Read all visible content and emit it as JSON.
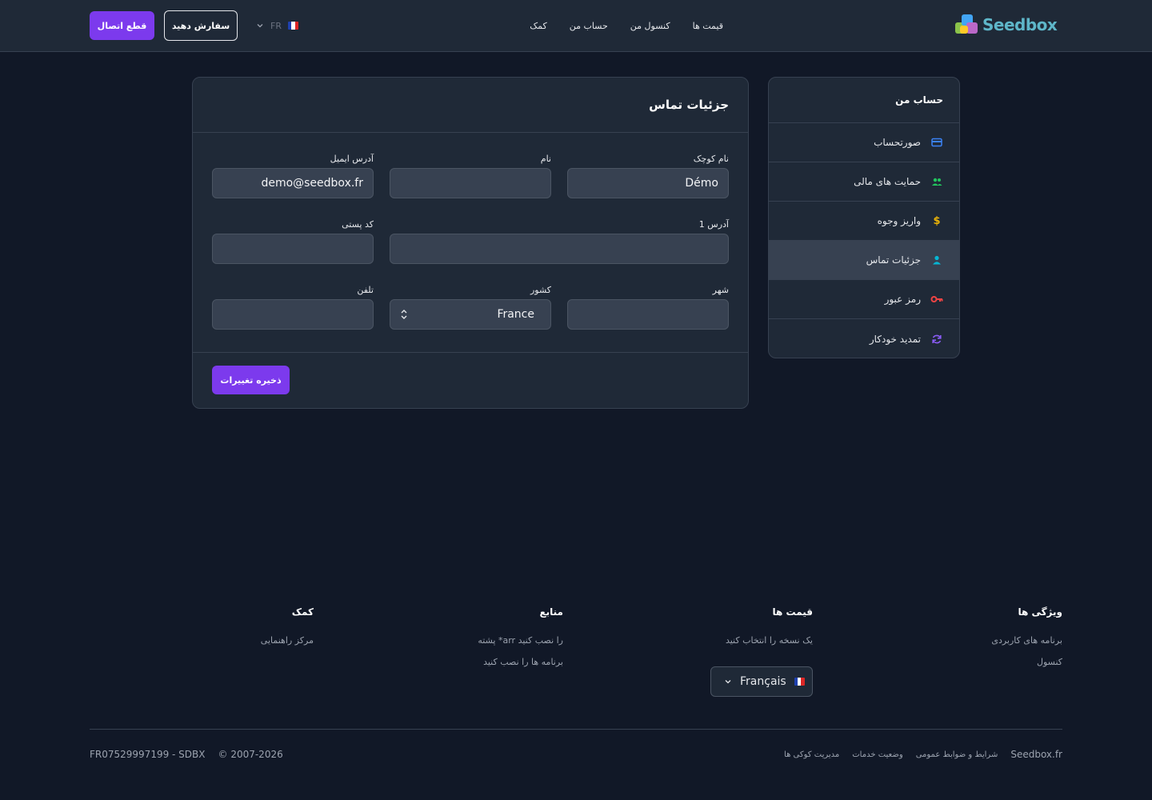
{
  "header": {
    "logo_text": "Seedbox",
    "nav": [
      "قیمت ها",
      "کنسول من",
      "حساب من",
      "کمک"
    ],
    "lang_code": "FR",
    "order_label": "سفارش دهید",
    "logout_label": "قطع اتصال"
  },
  "sidebar": {
    "title": "حساب من",
    "items": [
      {
        "label": "صورتحساب",
        "icon": "credit-card-icon",
        "color": "#3b82f6"
      },
      {
        "label": "حمایت های مالی",
        "icon": "users-icon",
        "color": "#22c55e"
      },
      {
        "label": "واریز وجوه",
        "icon": "dollar-icon",
        "color": "#eab308"
      },
      {
        "label": "جزئیات تماس",
        "icon": "user-icon",
        "color": "#06b6d4",
        "active": true
      },
      {
        "label": "رمز عبور",
        "icon": "key-icon",
        "color": "#ef4444"
      },
      {
        "label": "تمدید خودکار",
        "icon": "refresh-icon",
        "color": "#8b5cf6"
      }
    ]
  },
  "form": {
    "title": "جزئیات تماس",
    "first_name": {
      "label": "نام کوچک",
      "value": "Démo"
    },
    "last_name": {
      "label": "نام",
      "value": ""
    },
    "email": {
      "label": "آدرس ایمیل",
      "value": "demo@seedbox.fr"
    },
    "address": {
      "label": "آدرس 1",
      "value": ""
    },
    "postal_code": {
      "label": "کد پستی",
      "value": ""
    },
    "city": {
      "label": "شهر",
      "value": ""
    },
    "country": {
      "label": "کشور",
      "value": "France"
    },
    "phone": {
      "label": "تلفن",
      "value": ""
    },
    "save_label": "ذخیره تغییرات"
  },
  "footer": {
    "features": {
      "title": "ویژگی ها",
      "links": [
        "برنامه های کاربردی",
        "کنسول"
      ]
    },
    "pricing": {
      "title": "قیمت ها",
      "links": [
        "یک نسخه را انتخاب کنید"
      ]
    },
    "resources": {
      "title": "منابع",
      "links": [
        "پشته *arr را نصب کنید",
        "برنامه ها را نصب کنید"
      ]
    },
    "help": {
      "title": "کمک",
      "links": [
        "مرکز راهنمایی"
      ]
    },
    "language": "Français",
    "bottom_links": [
      "Seedbox.fr",
      "شرایط و ضوابط عمومی",
      "وضعیت خدمات",
      "مدیریت کوکی ها"
    ],
    "copyright": "© 2007-2026",
    "company": "FR07529997199 - SDBX"
  },
  "colors": {
    "accent": "#7c3aed",
    "background": "#111827",
    "surface": "#1f2937"
  }
}
